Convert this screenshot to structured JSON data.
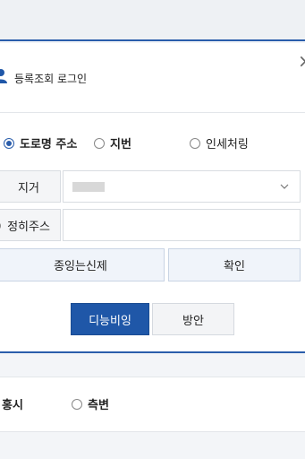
{
  "header": {
    "title": "등록조회 로그인"
  },
  "search_type": {
    "options": [
      {
        "label": "도로명 주소",
        "selected": true
      },
      {
        "label": "지번",
        "selected": false
      },
      {
        "label": "인세처링",
        "selected": false
      }
    ]
  },
  "fields": {
    "region_label": "지거",
    "address_label": "정히주스",
    "address_value": ""
  },
  "buttons": {
    "left": "종잉는신제",
    "right": "확인",
    "primary": "디능비잉",
    "secondary": "방안"
  },
  "lower_options": [
    {
      "label": "홍시"
    },
    {
      "label": "측변"
    }
  ],
  "colors": {
    "accent": "#1f57a8",
    "border": "#d8dce1"
  }
}
